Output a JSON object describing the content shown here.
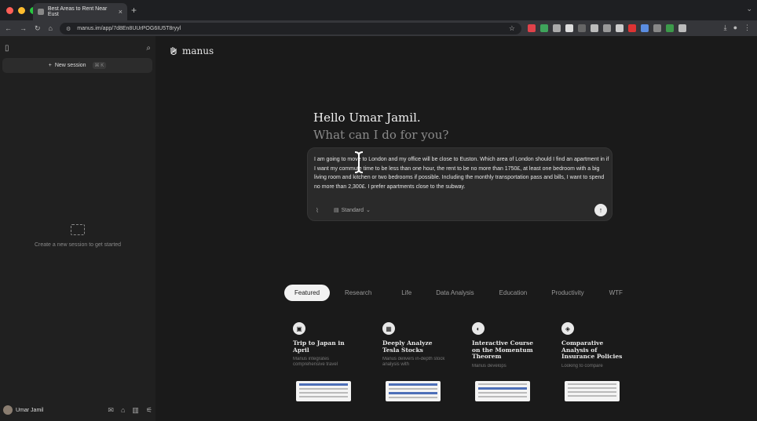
{
  "browser": {
    "tab_title": "Best Areas to Rent Near Eust",
    "url": "manus.im/app/7d8En8UUrPOG6IU5T8ryyl",
    "new_tab": "+",
    "tab_close": "×"
  },
  "sidebar": {
    "new_session_label": "New session",
    "new_session_shortcut": "⌘ K",
    "empty_text": "Create a new session to get started",
    "user_name": "Umar Jamil"
  },
  "main": {
    "logo_text": "manus",
    "greeting": "Hello Umar Jamil.",
    "subgreeting": "What can I do for you?",
    "composer_text": "I am going to move to London and my office will be close to Euston. Which area of London should I find an apartment in if I want my commute time to be less than one hour, the rent to be no more than 1750£, at least one bedroom with a big living room and kitchen or two bedrooms if possible. Including the monthly transportation pass and bills, I want to spend no more than 2,300£. I prefer apartments close to the subway.",
    "mode_label": "Standard",
    "tabs": [
      "Featured",
      "Research",
      "Life",
      "Data Analysis",
      "Education",
      "Productivity",
      "WTF"
    ],
    "cards": [
      {
        "title": "Trip to Japan in April",
        "desc": "Manus integrates comprehensive travel",
        "icon": "suitcase-icon"
      },
      {
        "title": "Deeply Analyze Tesla Stocks",
        "desc": "Manus delivers in-depth stock analysis with",
        "icon": "grid-icon"
      },
      {
        "title": "Interactive Course on the Momentum Theorem",
        "desc": "Manus develops",
        "icon": "speaker-icon"
      },
      {
        "title": "Comparative Analysis of Insurance Policies",
        "desc": "Looking to compare",
        "icon": "shield-icon"
      }
    ]
  },
  "colors": {
    "background": "#1a1a1a",
    "sidebar": "#202020",
    "composer": "#2a2a2a",
    "active_tab": "#f2f2f2"
  }
}
